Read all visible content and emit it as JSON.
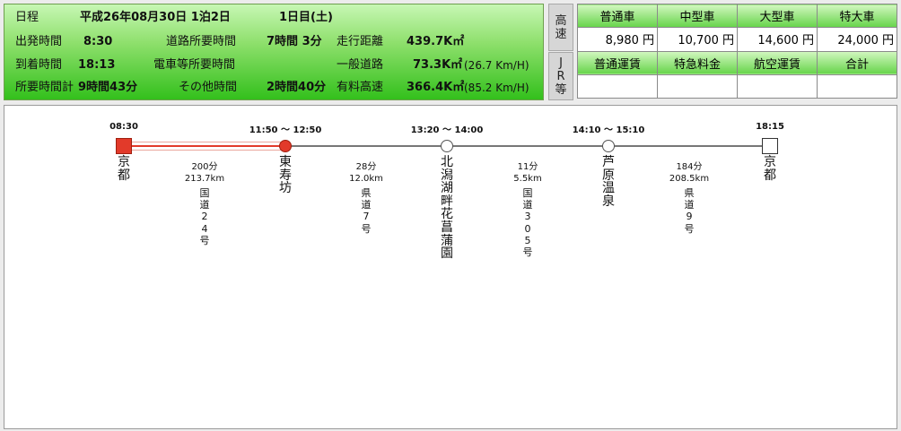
{
  "summary": {
    "schedule_label": "日程",
    "date": "平成26年08月30日 1泊2日",
    "day": "1日目(土)",
    "depart_label": "出発時間",
    "depart_time": "8:30",
    "arrive_label": "到着時間",
    "arrive_time": "18:13",
    "total_label": "所要時間計",
    "total_time": "9時間43分",
    "road_time_label": "道路所要時間",
    "road_time": "7時間 3分",
    "train_time_label": "電車等所要時間",
    "other_time_label": "その他時間",
    "other_time": "2時間40分",
    "distance_label": "走行距離",
    "distance": "439.7K㎡",
    "general_label": "一般道路",
    "general_distance": "73.3K㎡",
    "general_speed": "(26.7 Km/H)",
    "expressway_label": "有料高速",
    "expressway_distance": "366.4K㎡",
    "expressway_speed": "(85.2 Km/H)"
  },
  "tabs": {
    "highway": "高速",
    "jr": "JR等"
  },
  "fees": {
    "headers1": [
      "普通車",
      "中型車",
      "大型車",
      "特大車"
    ],
    "values1": [
      "8,980 円",
      "10,700 円",
      "14,600 円",
      "24,000 円"
    ],
    "headers2": [
      "普通運賃",
      "特急料金",
      "航空運賃",
      "合計"
    ],
    "values2": [
      "",
      "",
      "",
      ""
    ]
  },
  "route": {
    "stops": [
      {
        "time": "08:30",
        "name": "京都",
        "marker": "square-red"
      },
      {
        "time": "11:50 〜 12:50",
        "name": "東寿坊",
        "marker": "circle-red"
      },
      {
        "time": "13:20 〜 14:00",
        "name": "北潟湖畔花菖蒲園",
        "marker": "circle-white"
      },
      {
        "time": "14:10 〜 15:10",
        "name": "芦原温泉",
        "marker": "circle-white"
      },
      {
        "time": "18:15",
        "name": "京都",
        "marker": "square-white"
      }
    ],
    "segments": [
      {
        "duration": "200分",
        "distance": "213.7km",
        "road": "国道24号"
      },
      {
        "duration": "28分",
        "distance": "12.0km",
        "road": "県道7号"
      },
      {
        "duration": "11分",
        "distance": "5.5km",
        "road": "国道305号"
      },
      {
        "duration": "184分",
        "distance": "208.5km",
        "road": "県道9号"
      }
    ]
  },
  "colors": {
    "accent_red": "#e23a2a",
    "header_green": "#33c01c"
  }
}
